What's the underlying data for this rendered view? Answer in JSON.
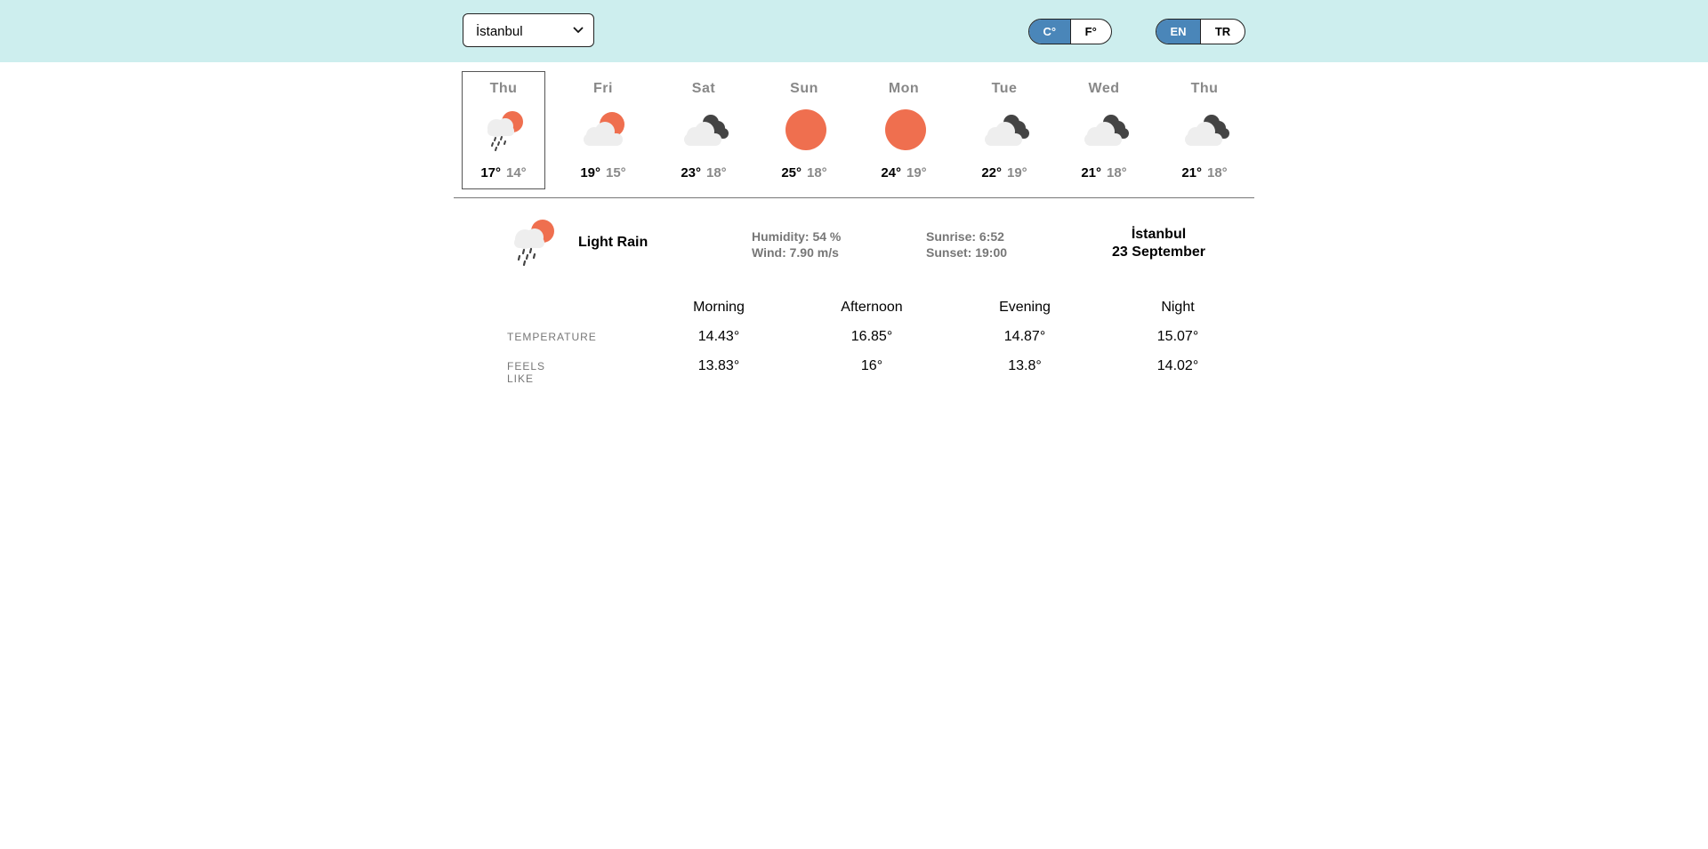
{
  "header": {
    "city_select": {
      "value": "İstanbul"
    },
    "units": [
      {
        "label": "C°",
        "active": true
      },
      {
        "label": "F°",
        "active": false
      }
    ],
    "languages": [
      {
        "label": "EN",
        "active": true
      },
      {
        "label": "TR",
        "active": false
      }
    ]
  },
  "forecast": [
    {
      "day": "Thu",
      "icon": "light-rain-sun-icon",
      "high": "17°",
      "low": "14°",
      "selected": true
    },
    {
      "day": "Fri",
      "icon": "cloud-sun-icon",
      "high": "19°",
      "low": "15°",
      "selected": false
    },
    {
      "day": "Sat",
      "icon": "dark-clouds-icon",
      "high": "23°",
      "low": "18°",
      "selected": false
    },
    {
      "day": "Sun",
      "icon": "sun-icon",
      "high": "25°",
      "low": "18°",
      "selected": false
    },
    {
      "day": "Mon",
      "icon": "sun-icon",
      "high": "24°",
      "low": "19°",
      "selected": false
    },
    {
      "day": "Tue",
      "icon": "dark-clouds-icon",
      "high": "22°",
      "low": "19°",
      "selected": false
    },
    {
      "day": "Wed",
      "icon": "dark-clouds-icon",
      "high": "21°",
      "low": "18°",
      "selected": false
    },
    {
      "day": "Thu",
      "icon": "dark-clouds-icon",
      "high": "21°",
      "low": "18°",
      "selected": false
    }
  ],
  "current": {
    "icon": "light-rain-sun-icon",
    "description": "Light Rain",
    "humidity": "Humidity: 54 %",
    "wind": "Wind: 7.90 m/s",
    "sunrise": "Sunrise: 6:52",
    "sunset": "Sunset: 19:00",
    "city": "İstanbul",
    "date": "23 September"
  },
  "periods": {
    "columns": [
      "Morning",
      "Afternoon",
      "Evening",
      "Night"
    ],
    "rows": [
      {
        "label": "TEMPERATURE",
        "values": [
          "14.43°",
          "16.85°",
          "14.87°",
          "15.07°"
        ]
      },
      {
        "label": "FEELS LIKE",
        "values": [
          "13.83°",
          "16°",
          "13.8°",
          "14.02°"
        ]
      }
    ]
  },
  "colors": {
    "topbar": "#cdeeee",
    "accent": "#4a86b9",
    "sun": "#ef6f4f",
    "cloud": "#eeeeee",
    "dark_cloud": "#444444"
  }
}
